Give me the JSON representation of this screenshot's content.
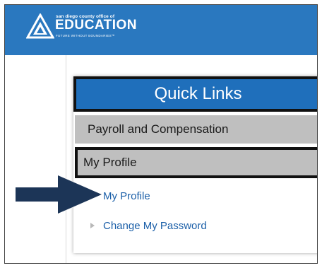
{
  "header": {
    "logo_tagline_top": "san diego county office of",
    "logo_word": "EDUCATION",
    "logo_tagline_bottom": "FUTURE WITHOUT BOUNDARIES™"
  },
  "quick_links": {
    "title": "Quick Links",
    "items": [
      {
        "label": "Payroll and Compensation"
      },
      {
        "label": "My Profile"
      }
    ],
    "sub_links": [
      {
        "label": "My Profile"
      },
      {
        "label": "Change My Password"
      }
    ]
  },
  "colors": {
    "header_blue": "#2a78bf",
    "panel_header_blue": "#1f6fbb",
    "row_gray": "#bfbfbf",
    "link_blue": "#1b5fa8",
    "arrow_navy": "#1c3557"
  },
  "icons": {
    "logo": "sdcoe-triangle-logo",
    "annotation": "pointing-arrow-icon",
    "bullet": "triangle-bullet-icon"
  }
}
